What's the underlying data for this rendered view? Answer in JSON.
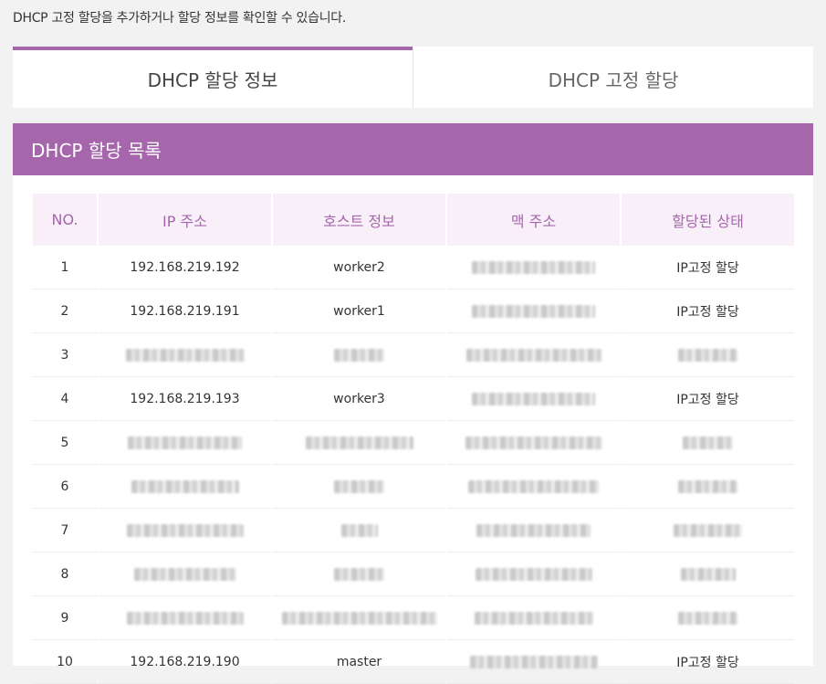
{
  "description": "DHCP 고정 할당을 추가하거나 할당 정보를 확인할 수 있습니다.",
  "tabs": [
    {
      "label": "DHCP 할당 정보",
      "active": true
    },
    {
      "label": "DHCP 고정 할당",
      "active": false
    }
  ],
  "panel": {
    "title": "DHCP 할당 목록"
  },
  "colors": {
    "accent": "#a566ab",
    "header_bg": "#f9eff8"
  },
  "table": {
    "headers": [
      "NO.",
      "IP 주소",
      "호스트 정보",
      "맥 주소",
      "할당된 상태"
    ],
    "rows": [
      {
        "no": "1",
        "ip": "192.168.219.192",
        "host": "worker2",
        "mac": "",
        "status": "IP고정 할당"
      },
      {
        "no": "2",
        "ip": "192.168.219.191",
        "host": "worker1",
        "mac": "",
        "status": "IP고정 할당"
      },
      {
        "no": "3",
        "ip": "",
        "host": "",
        "mac": "",
        "status": ""
      },
      {
        "no": "4",
        "ip": "192.168.219.193",
        "host": "worker3",
        "mac": "",
        "status": "IP고정 할당"
      },
      {
        "no": "5",
        "ip": "",
        "host": "",
        "mac": "",
        "status": ""
      },
      {
        "no": "6",
        "ip": "",
        "host": "",
        "mac": "",
        "status": ""
      },
      {
        "no": "7",
        "ip": "",
        "host": "",
        "mac": "",
        "status": ""
      },
      {
        "no": "8",
        "ip": "",
        "host": "",
        "mac": "",
        "status": ""
      },
      {
        "no": "9",
        "ip": "",
        "host": "",
        "mac": "",
        "status": ""
      },
      {
        "no": "10",
        "ip": "192.168.219.190",
        "host": "master",
        "mac": "",
        "status": "IP고정 할당"
      }
    ]
  }
}
